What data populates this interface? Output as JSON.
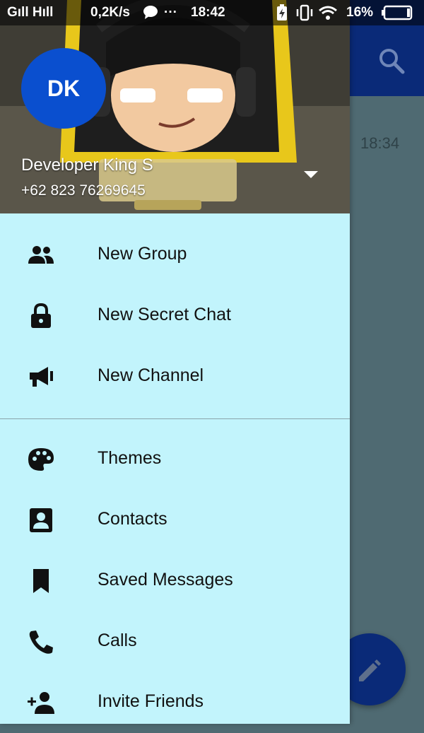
{
  "status_bar": {
    "signal": "Gıll Hıll",
    "speed": "0,2K/s",
    "dots": "···",
    "time": "18:42",
    "battery": "16%"
  },
  "background_chat": {
    "time": "18:34"
  },
  "drawer": {
    "avatar_initials": "DK",
    "user_name": "Developer King S",
    "phone": "+62 823 76269645",
    "menu_top": [
      {
        "label": "New Group",
        "icon": "group-icon"
      },
      {
        "label": "New Secret Chat",
        "icon": "lock-icon"
      },
      {
        "label": "New Channel",
        "icon": "megaphone-icon"
      }
    ],
    "menu_bottom": [
      {
        "label": "Themes",
        "icon": "palette-icon"
      },
      {
        "label": "Contacts",
        "icon": "contact-card-icon"
      },
      {
        "label": "Saved Messages",
        "icon": "bookmark-icon"
      },
      {
        "label": "Calls",
        "icon": "phone-icon"
      },
      {
        "label": "Invite Friends",
        "icon": "add-person-icon"
      }
    ]
  },
  "colors": {
    "drawer_bg": "#c2f4fc",
    "header_blue": "#0a2a78",
    "avatar_blue": "#0a4fcf",
    "dim_overlay": "#4f6a72"
  }
}
